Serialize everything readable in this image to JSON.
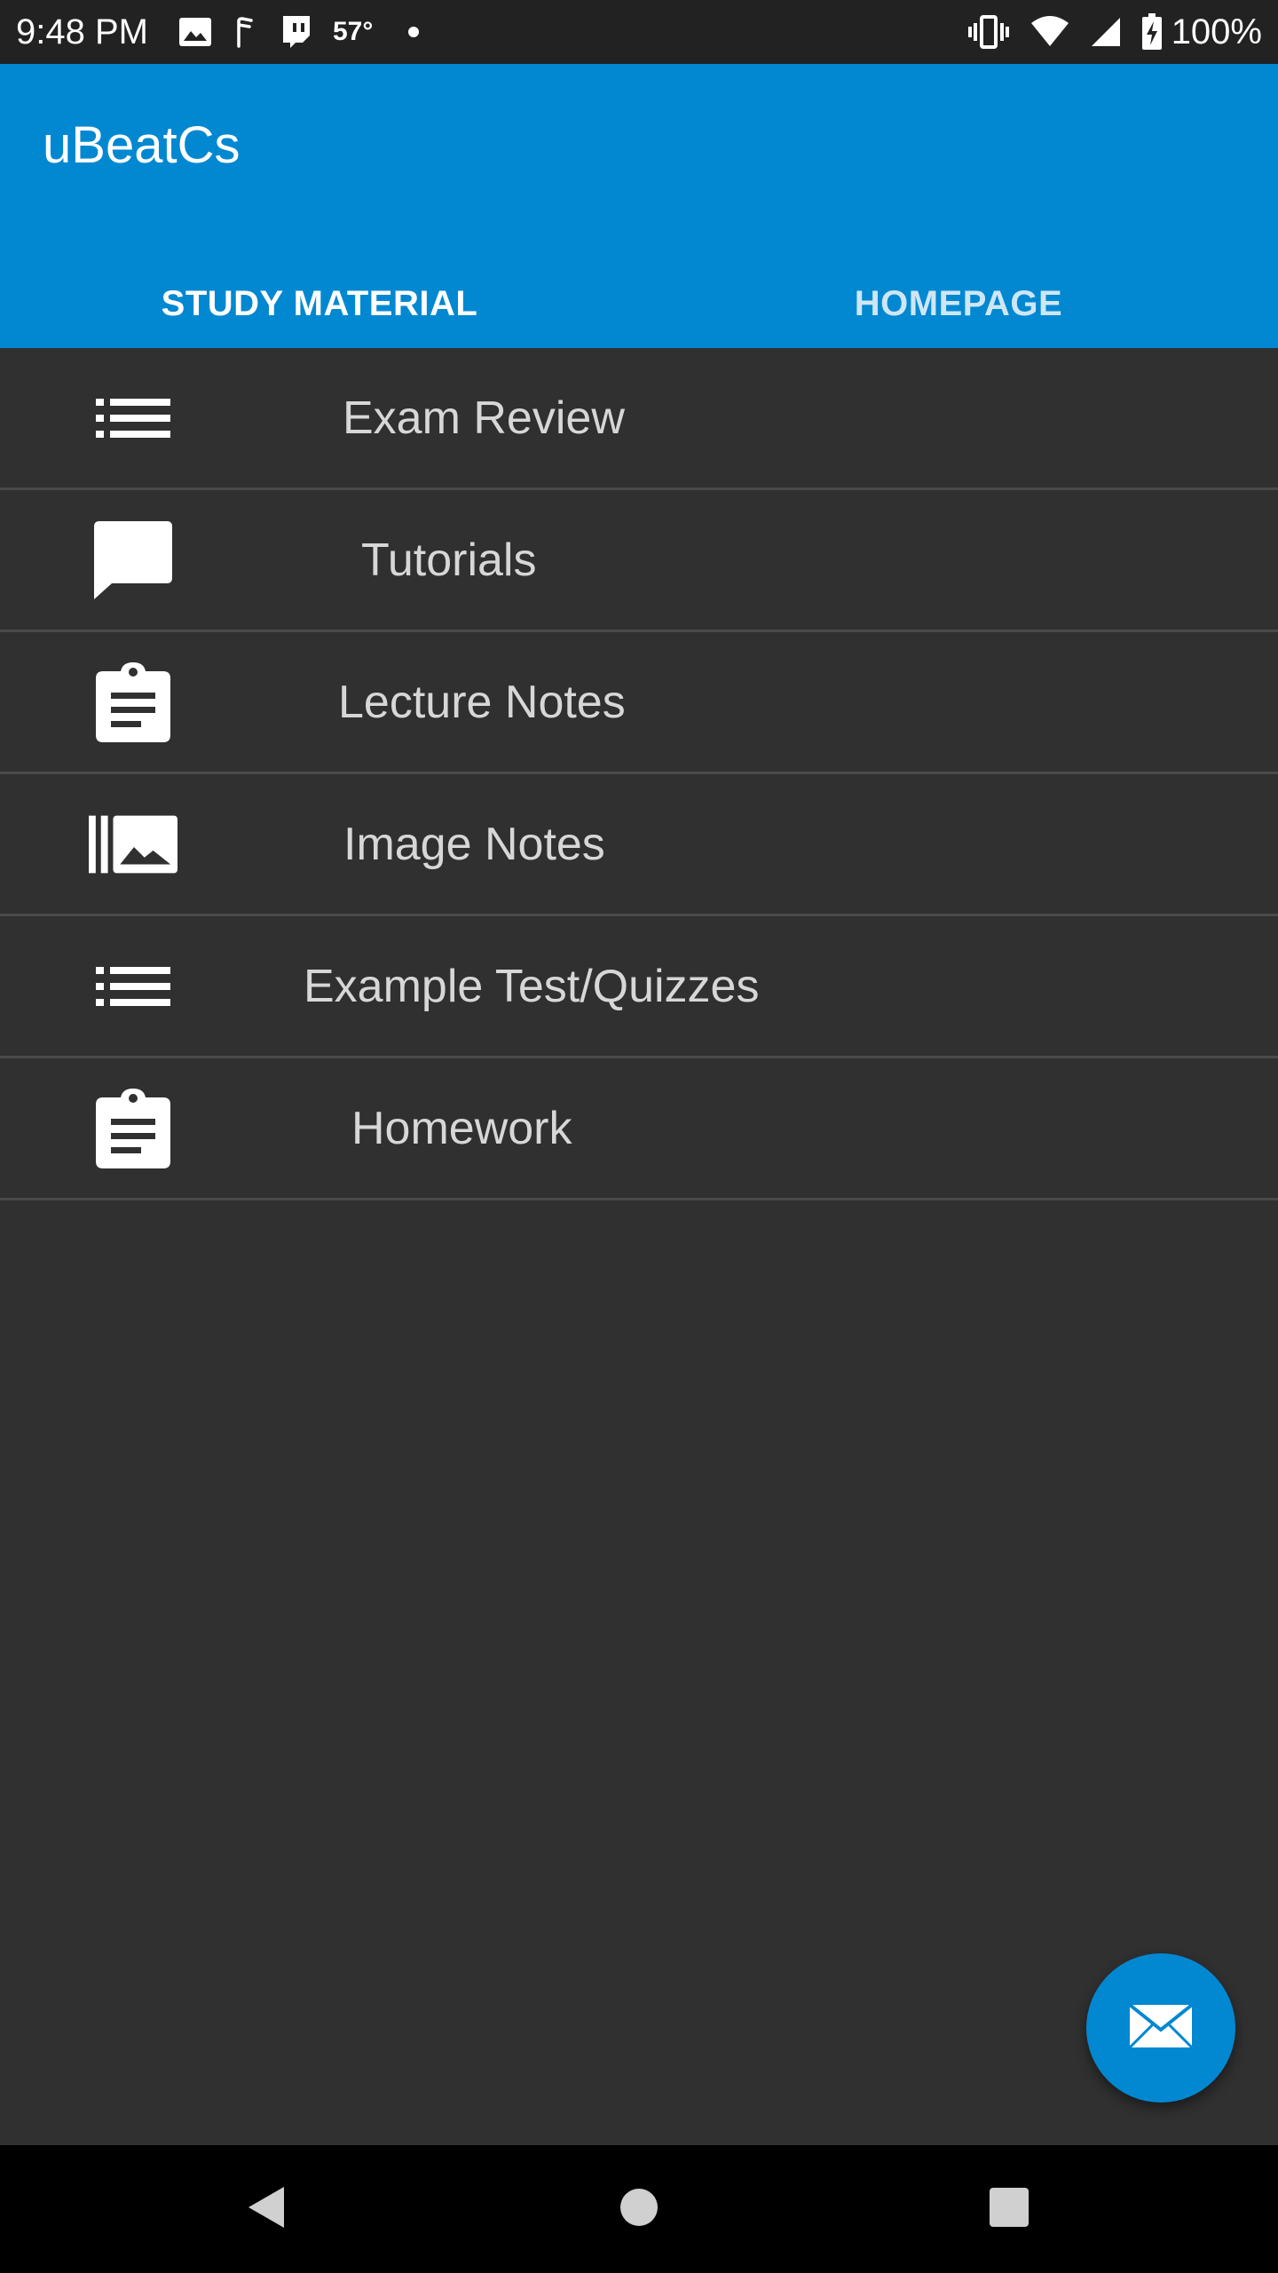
{
  "status_bar": {
    "time": "9:48 PM",
    "temperature": "57°",
    "battery": "100%",
    "left_icons": [
      "image-icon",
      "fitness-icon",
      "twitch-icon"
    ],
    "right_icons": [
      "vibrate-icon",
      "wifi-icon",
      "signal-icon",
      "battery-charging-icon"
    ]
  },
  "app_bar": {
    "title": "uBeatCs",
    "color": "#0288d1",
    "tabs": [
      {
        "label": "STUDY MATERIAL",
        "selected": true
      },
      {
        "label": "HOMEPAGE",
        "selected": false
      }
    ]
  },
  "list": {
    "items": [
      {
        "label": "Exam Review",
        "icon": "list-icon"
      },
      {
        "label": "Tutorials",
        "icon": "chat-bubble-icon"
      },
      {
        "label": "Lecture Notes",
        "icon": "clipboard-icon"
      },
      {
        "label": "Image Notes",
        "icon": "image-library-icon"
      },
      {
        "label": "Example Test/Quizzes",
        "icon": "list-icon"
      },
      {
        "label": "Homework",
        "icon": "clipboard-icon"
      }
    ]
  },
  "fab": {
    "icon": "mail-icon"
  },
  "nav_bar": {
    "buttons": [
      "back-icon",
      "home-icon",
      "recents-icon"
    ]
  }
}
